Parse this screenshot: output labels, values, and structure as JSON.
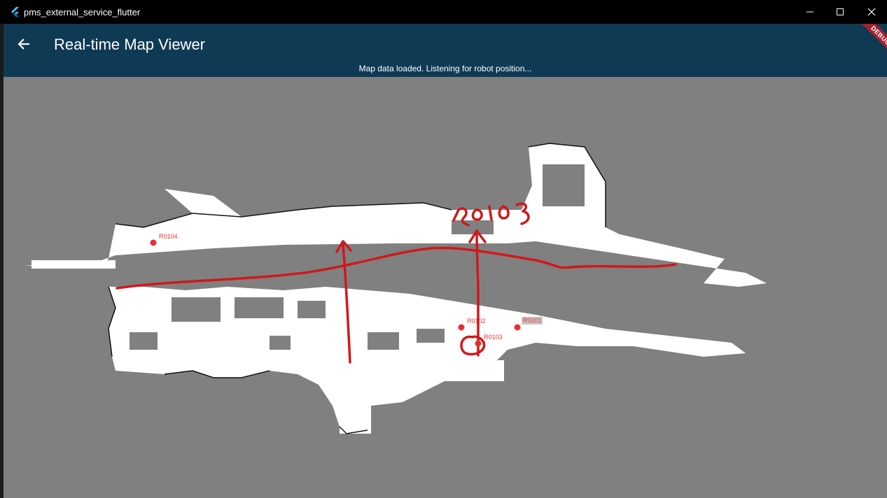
{
  "window": {
    "title": "pms_external_service_flutter"
  },
  "appbar": {
    "title": "Real-time Map Viewer",
    "status": "Map data loaded. Listening for robot position...",
    "debug_banner": "DEBUG"
  },
  "map": {
    "rooms": [
      {
        "id": "R0104",
        "label": "R0104"
      },
      {
        "id": "R0102",
        "label": "R0102"
      },
      {
        "id": "R0101",
        "label": "R0101"
      },
      {
        "id": "R0103",
        "label": "R0103"
      }
    ],
    "annotation_text": "R0103",
    "marker_color": "#e53030",
    "annotation_color": "#d0181c"
  }
}
